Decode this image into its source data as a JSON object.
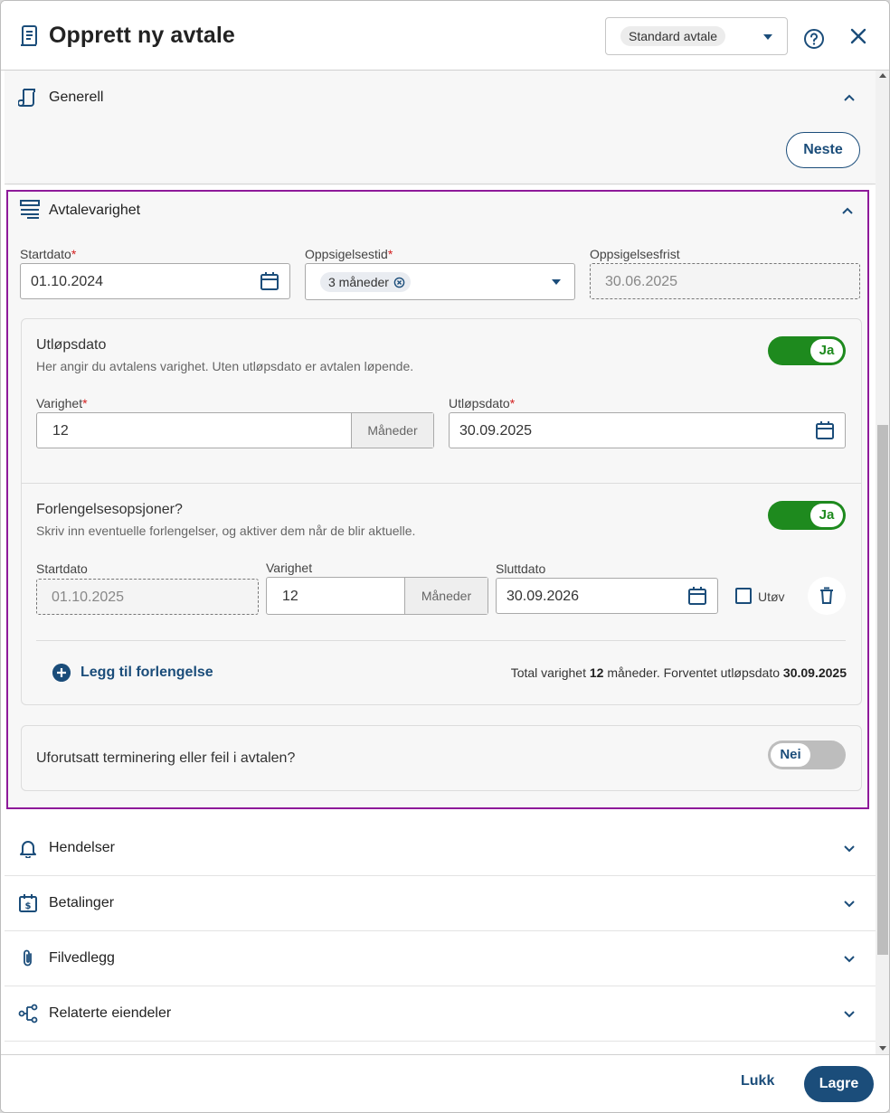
{
  "header": {
    "title": "Opprett ny avtale",
    "agreement_type": "Standard avtale"
  },
  "sections": {
    "generell": {
      "title": "Generell",
      "next_label": "Neste"
    },
    "avtalevarighet": {
      "title": "Avtalevarighet",
      "startdato": {
        "label": "Startdato",
        "value": "01.10.2024"
      },
      "oppsigelsestid": {
        "label": "Oppsigelsestid",
        "value": "3 måneder"
      },
      "oppsigelsesfrist": {
        "label": "Oppsigelsesfrist",
        "value": "30.06.2025"
      },
      "utlopsdato_panel": {
        "title": "Utløpsdato",
        "description": "Her angir du avtalens varighet. Uten utløpsdato er avtalen løpende.",
        "toggle": "Ja",
        "varighet": {
          "label": "Varighet",
          "value": "12",
          "unit": "Måneder"
        },
        "utlopsdato": {
          "label": "Utløpsdato",
          "value": "30.09.2025"
        }
      },
      "forlengelse_panel": {
        "title": "Forlengelsesopsjoner?",
        "description": "Skriv inn eventuelle forlengelser, og aktiver dem når de blir aktuelle.",
        "toggle": "Ja",
        "startdato": {
          "label": "Startdato",
          "value": "01.10.2025"
        },
        "varighet": {
          "label": "Varighet",
          "value": "12",
          "unit": "Måneder"
        },
        "sluttdato": {
          "label": "Sluttdato",
          "value": "30.09.2026"
        },
        "utov_label": "Utøv",
        "add_label": "Legg til forlengelse",
        "total_prefix": "Total varighet",
        "total_months": "12",
        "total_mid": "måneder. Forventet utløpsdato",
        "total_date": "30.09.2025"
      },
      "terminering": {
        "title": "Uforutsatt terminering eller feil i avtalen?",
        "toggle": "Nei"
      }
    },
    "hendelser": {
      "title": "Hendelser"
    },
    "betalinger": {
      "title": "Betalinger"
    },
    "filvedlegg": {
      "title": "Filvedlegg"
    },
    "relaterte": {
      "title": "Relaterte eiendeler"
    }
  },
  "footer": {
    "close_label": "Lukk",
    "save_label": "Lagre"
  },
  "colors": {
    "primary": "#1b4d7a",
    "toggle_on": "#1e8a1e",
    "highlight_border": "#8e1a9a",
    "required": "#d32020"
  }
}
